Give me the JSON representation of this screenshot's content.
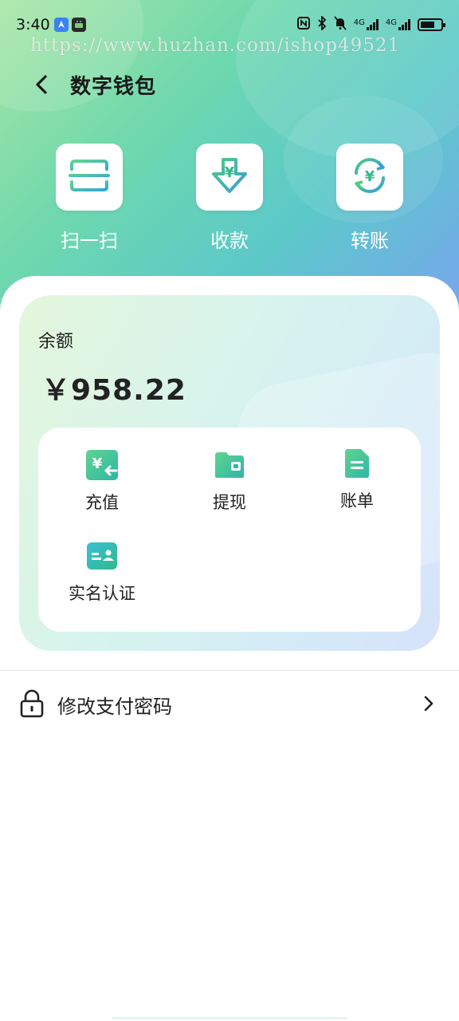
{
  "status_bar": {
    "time": "3:40",
    "icons": [
      "navigation-app-icon",
      "android-app-icon",
      "nfc-icon",
      "bluetooth-icon",
      "mute-bell-icon",
      "signal-4g-icon",
      "signal-4g-icon",
      "battery-icon"
    ],
    "network_1": "4G",
    "network_2": "4G"
  },
  "watermark": "https://www.huzhan.com/ishop49521",
  "header": {
    "title": "数字钱包"
  },
  "quick_actions": [
    {
      "label": "扫一扫",
      "icon": "scan-icon"
    },
    {
      "label": "收款",
      "icon": "receive-money-icon"
    },
    {
      "label": "转账",
      "icon": "transfer-icon"
    }
  ],
  "balance": {
    "label": "余额",
    "amount": "￥958.22"
  },
  "operations": [
    {
      "label": "充值",
      "icon": "recharge-icon"
    },
    {
      "label": "提现",
      "icon": "withdraw-wallet-icon"
    },
    {
      "label": "账单",
      "icon": "bill-document-icon"
    },
    {
      "label": "实名认证",
      "icon": "id-card-icon"
    }
  ],
  "menu": {
    "change_password_label": "修改支付密码"
  },
  "colors": {
    "accent_green": "#3cc08c",
    "accent_blue": "#3ba7e0",
    "icon_green": "#2fb98a"
  }
}
